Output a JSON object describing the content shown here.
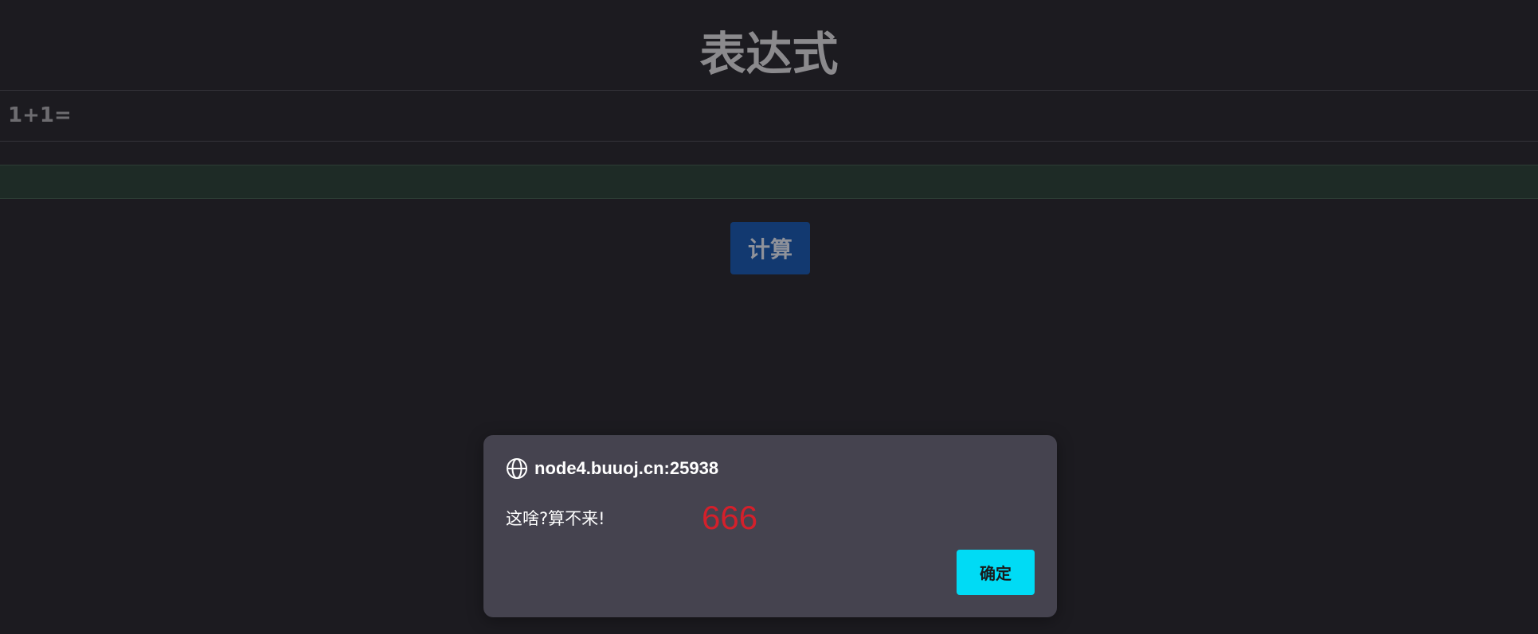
{
  "page": {
    "title": "表达式",
    "expression": "1+1=",
    "answer_value": "",
    "calculate_label": "计算"
  },
  "alert": {
    "origin": "node4.buuoj.cn:25938",
    "message": "这啥?算不来!",
    "extra_text": "666",
    "ok_label": "确定",
    "icon": "globe-icon"
  },
  "colors": {
    "background": "#1c1b20",
    "input_background": "#1e2b26",
    "calculate_button": "#123970",
    "dialog_background": "#45434f",
    "ok_button": "#00dbf5",
    "extra_text": "#d4202b"
  }
}
